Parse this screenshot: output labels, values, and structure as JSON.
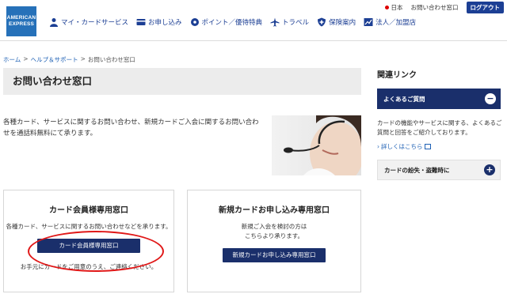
{
  "logo": {
    "line1": "AMERICAN",
    "line2": "EXPRESS"
  },
  "util": {
    "lang": "日本",
    "contact": "お問い合わせ窓口",
    "logout": "ログアウト"
  },
  "nav": [
    {
      "label": "マイ・カードサービス",
      "icon": "person-icon"
    },
    {
      "label": "お申し込み",
      "icon": "card-icon"
    },
    {
      "label": "ポイント／優待特典",
      "icon": "gear-icon"
    },
    {
      "label": "トラベル",
      "icon": "airplane-icon"
    },
    {
      "label": "保険案内",
      "icon": "shield-icon"
    },
    {
      "label": "法人／加盟店",
      "icon": "chart-icon"
    }
  ],
  "breadcrumb": {
    "home": "ホーム",
    "help": "ヘルプ＆サポート",
    "current": "お問い合わせ窓口",
    "sep": ">"
  },
  "page_title": "お問い合わせ窓口",
  "intro": "各種カード、サービスに関するお問い合わせ、新規カードご入会に関するお問い合わせを通話料無料にて承ります。",
  "cards": [
    {
      "title": "カード会員様専用窓口",
      "text": "各種カード、サービスに関するお問い合わせなどを承ります。",
      "button": "カード会員様専用窓口",
      "note": "お手元にカードをご用意のうえ、ご連絡ください。"
    },
    {
      "title": "新規カードお申し込み専用窓口",
      "text": "新規ご入会を検討の方は\nこちらより承ります。",
      "button": "新規カードお申し込み専用窓口"
    }
  ],
  "sidebar": {
    "title": "関連リンク",
    "faq_label": "よくあるご質問",
    "faq_desc": "カードの機能やサービスに関する、よくあるご質問と回答をご紹介しております。",
    "faq_link": "詳しくはこちら",
    "lost_label": "カードの紛失・盗難時に",
    "collapse_symbol": "−",
    "expand_symbol": "+"
  },
  "colors": {
    "navy": "#1a2f6b",
    "brand_blue": "#2671b9",
    "highlight_red": "#e01818"
  }
}
